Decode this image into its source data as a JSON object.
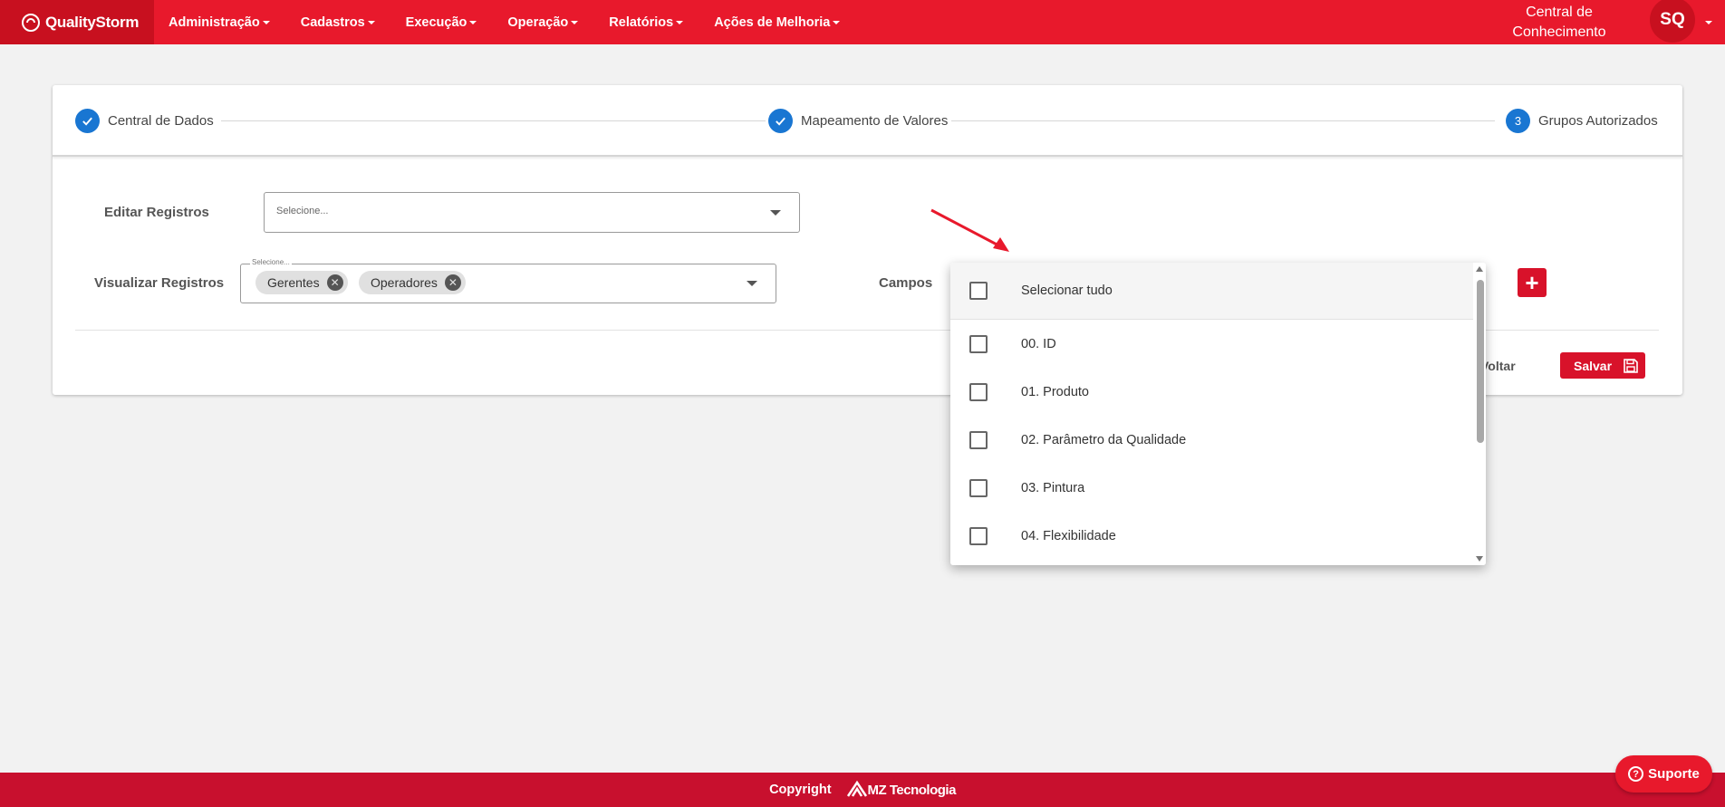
{
  "navbar": {
    "brand": "QualityStorm",
    "menu": [
      {
        "label": "Administração"
      },
      {
        "label": "Cadastros"
      },
      {
        "label": "Execução"
      },
      {
        "label": "Operação"
      },
      {
        "label": "Relatórios"
      },
      {
        "label": "Ações de Melhoria"
      }
    ],
    "knowledge_center": "Central de Conhecimento",
    "avatar_initials": "SQ"
  },
  "stepper": {
    "steps": [
      {
        "label": "Central de Dados",
        "status": "done"
      },
      {
        "label": "Mapeamento de Valores",
        "status": "done"
      },
      {
        "label": "Grupos Autorizados",
        "status": "active",
        "number": "3"
      }
    ]
  },
  "form": {
    "edit_label": "Editar Registros",
    "edit_placeholder": "Selecione...",
    "view_label": "Visualizar Registros",
    "view_float_label": "Selecione...",
    "view_chips": [
      "Gerentes",
      "Operadores"
    ],
    "fields_label": "Campos"
  },
  "dropdown": {
    "select_all": "Selecionar tudo",
    "options": [
      "00. ID",
      "01. Produto",
      "02. Parâmetro da Qualidade",
      "03. Pintura",
      "04. Flexibilidade"
    ]
  },
  "actions": {
    "back": "Voltar",
    "save": "Salvar",
    "add": "+"
  },
  "footer": {
    "copyright": "Copyright",
    "company": "MZ Tecnologia"
  },
  "support": {
    "label": "Suporte"
  },
  "colors": {
    "primary_red": "#e8192c",
    "step_blue": "#1976d2"
  }
}
